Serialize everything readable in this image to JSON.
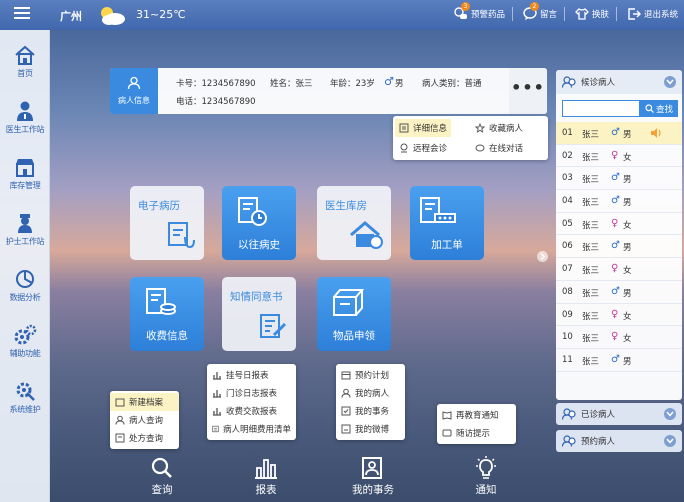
{
  "topbar": {
    "city": "广州",
    "temperature": "31~25℃",
    "actions": [
      {
        "label": "预警药品",
        "badge": "3"
      },
      {
        "label": "留言",
        "badge": "2"
      },
      {
        "label": "换肤"
      },
      {
        "label": "退出系统"
      }
    ]
  },
  "sidebar": {
    "items": [
      {
        "label": "首页"
      },
      {
        "label": "医生工作站"
      },
      {
        "label": "库存管理"
      },
      {
        "label": "护士工作站"
      },
      {
        "label": "数据分析"
      },
      {
        "label": "辅助功能"
      },
      {
        "label": "系统维护"
      }
    ]
  },
  "patient": {
    "button_label": "病人信息",
    "card_no": "卡号：1234567890",
    "name": "姓名：张三",
    "age": "年龄：23岁",
    "gender": "男",
    "category": "病人类别：普通",
    "phone": "电话：1234567890"
  },
  "popup": {
    "items": [
      {
        "label": "详细信息"
      },
      {
        "label": "收藏病人"
      },
      {
        "label": "远程会诊"
      },
      {
        "label": "在线对话"
      }
    ]
  },
  "tiles": [
    {
      "label": "电子病历"
    },
    {
      "label": "以往病史"
    },
    {
      "label": "医生库房"
    },
    {
      "label": "加工单"
    },
    {
      "label": "收费信息"
    },
    {
      "label": "知情同意书"
    },
    {
      "label": "物品申领"
    }
  ],
  "right_panel": {
    "header": "候诊病人",
    "search_button": "查找",
    "search_value": "",
    "patients": [
      {
        "no": "01",
        "name": "张三",
        "gender": "男",
        "selected": true
      },
      {
        "no": "02",
        "name": "张三",
        "gender": "女"
      },
      {
        "no": "03",
        "name": "张三",
        "gender": "男"
      },
      {
        "no": "04",
        "name": "张三",
        "gender": "男"
      },
      {
        "no": "05",
        "name": "张三",
        "gender": "女"
      },
      {
        "no": "06",
        "name": "张三",
        "gender": "男"
      },
      {
        "no": "07",
        "name": "张三",
        "gender": "女"
      },
      {
        "no": "08",
        "name": "张三",
        "gender": "男"
      },
      {
        "no": "09",
        "name": "张三",
        "gender": "女"
      },
      {
        "no": "10",
        "name": "张三",
        "gender": "女"
      },
      {
        "no": "11",
        "name": "张三",
        "gender": "男"
      }
    ],
    "seen": "已诊病人",
    "booked": "预约病人"
  },
  "dropups": {
    "query": [
      {
        "label": "新建档案"
      },
      {
        "label": "病人查询"
      },
      {
        "label": "处方查询"
      }
    ],
    "reports": [
      {
        "label": "挂号日报表"
      },
      {
        "label": "门诊日志报表"
      },
      {
        "label": "收费交款报表"
      },
      {
        "label": "病人明细费用清单"
      }
    ],
    "affairs": [
      {
        "label": "预约计划"
      },
      {
        "label": "我的病人"
      },
      {
        "label": "我的事务"
      },
      {
        "label": "我的微博"
      }
    ],
    "notice": [
      {
        "label": "再教育通知"
      },
      {
        "label": "随访提示"
      }
    ]
  },
  "bottom_nav": [
    {
      "label": "查询"
    },
    {
      "label": "报表"
    },
    {
      "label": "我的事务"
    },
    {
      "label": "通知"
    }
  ],
  "colors": {
    "accent": "#3a8be0",
    "male": "#2f6fc4",
    "female": "#c23b9a",
    "highlight": "#fbf3c4"
  }
}
